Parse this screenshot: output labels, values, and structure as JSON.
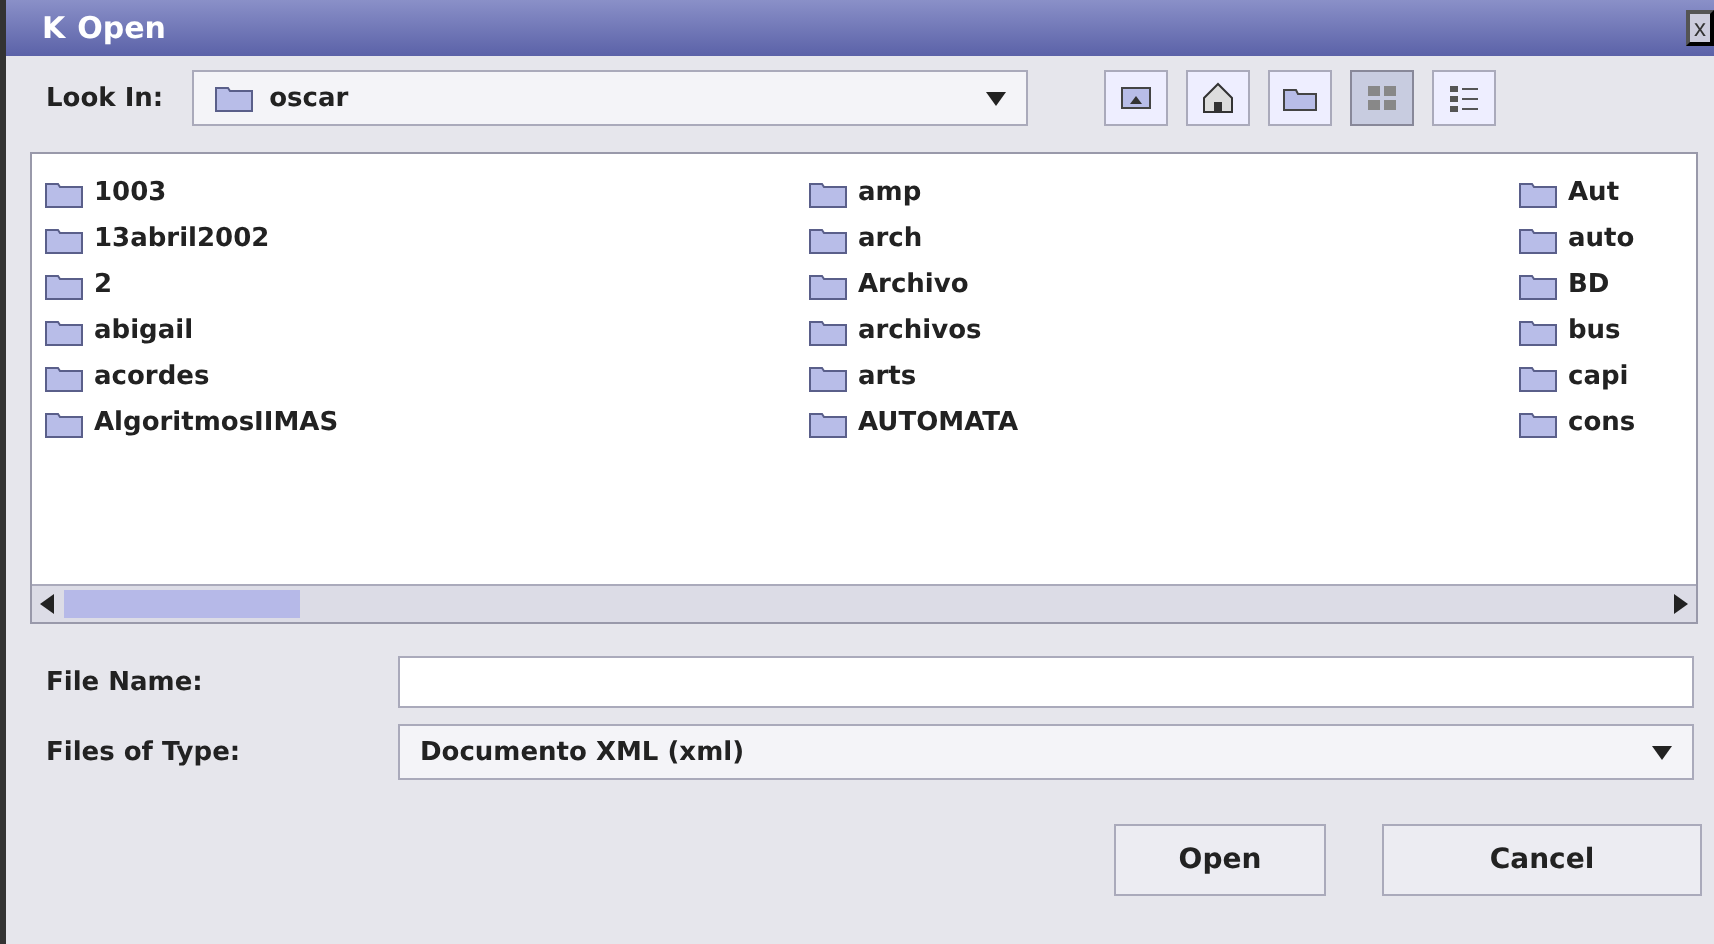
{
  "window": {
    "title": "Open",
    "logo": "K",
    "close": "x"
  },
  "look_in": {
    "label": "Look In:",
    "value": "oscar"
  },
  "toolbar": [
    {
      "kind": "up",
      "selected": false
    },
    {
      "kind": "home",
      "selected": false
    },
    {
      "kind": "new-folder",
      "selected": false
    },
    {
      "kind": "list",
      "selected": true
    },
    {
      "kind": "details",
      "selected": false
    }
  ],
  "files": [
    {
      "name": "1003"
    },
    {
      "name": "13abril2002"
    },
    {
      "name": "2"
    },
    {
      "name": "abigail"
    },
    {
      "name": "acordes"
    },
    {
      "name": "AlgoritmosIIMAS"
    },
    {
      "name": "amp"
    },
    {
      "name": "arch"
    },
    {
      "name": "Archivo"
    },
    {
      "name": "archivos"
    },
    {
      "name": "arts"
    },
    {
      "name": "AUTOMATA"
    },
    {
      "name": "Aut"
    },
    {
      "name": "auto"
    },
    {
      "name": "BD"
    },
    {
      "name": "bus"
    },
    {
      "name": "capi"
    },
    {
      "name": "cons"
    }
  ],
  "file_name": {
    "label": "File Name:"
  },
  "files_of_type": {
    "label": "Files of Type:",
    "value": "Documento XML (xml)"
  },
  "buttons": [
    "Open",
    "Cancel"
  ]
}
